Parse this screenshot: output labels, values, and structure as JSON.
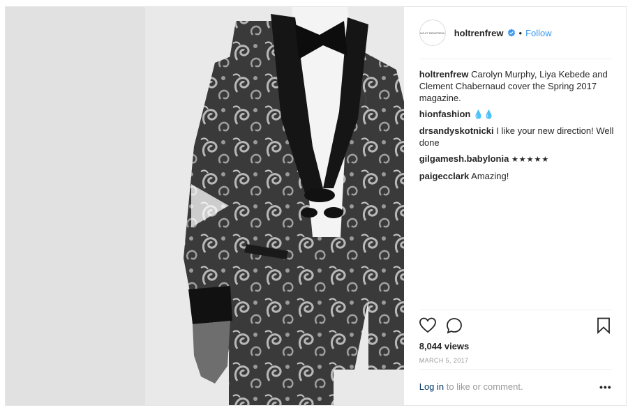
{
  "post": {
    "avatar_text": "HOLT RENFREW",
    "username": "holtrenfrew",
    "follow_label": "Follow",
    "separator": "•",
    "comments": [
      {
        "user": "holtrenfrew",
        "text": "Carolyn Murphy, Liya Kebede and Clement Chabernaud cover the Spring 2017 magazine."
      },
      {
        "user": "hionfashion",
        "text": "💧💧"
      },
      {
        "user": "drsandyskotnicki",
        "text": "I like your new direction! Well done"
      },
      {
        "user": "gilgamesh.babylonia",
        "text": "★★★★★"
      },
      {
        "user": "paigecclark",
        "text": "Amazing!"
      }
    ],
    "views": "8,044 views",
    "date": "MARCH 5, 2017",
    "login_link": "Log in",
    "login_rest": "to like or comment.",
    "more_label": "•••"
  },
  "icons": {
    "verified": "verified-badge-icon",
    "like": "heart-icon",
    "comment": "comment-bubble-icon",
    "save": "bookmark-icon",
    "play": "play-icon"
  },
  "colors": {
    "link": "#3897f0",
    "login": "#003569",
    "muted": "#999999"
  }
}
